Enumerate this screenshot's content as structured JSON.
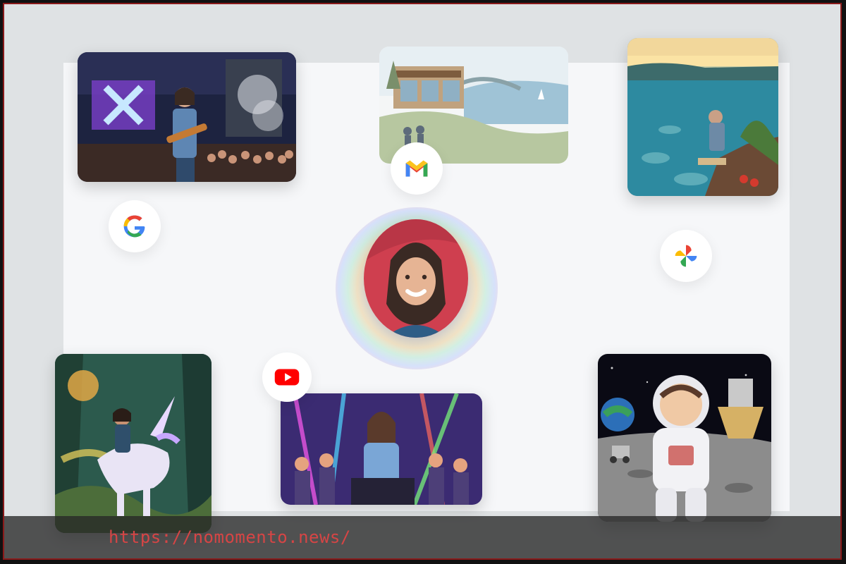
{
  "scene": {
    "center_avatar": "avatar-portrait",
    "apps": [
      {
        "name": "gmail-icon"
      },
      {
        "name": "google-icon"
      },
      {
        "name": "photos-icon"
      },
      {
        "name": "youtube-icon"
      }
    ],
    "photos": [
      "concert-photo",
      "coastal-house-watercolor",
      "seaside-reading-painting",
      "unicorn-forest-illustration",
      "dj-party-illustration",
      "astronaut-moon-photo"
    ]
  },
  "colors": {
    "google_blue": "#4285F4",
    "google_red": "#EA4335",
    "google_yellow": "#FBBC05",
    "google_green": "#34A853",
    "youtube_red": "#FF0000"
  },
  "watermark": {
    "url": "https://nomomento.news/"
  }
}
